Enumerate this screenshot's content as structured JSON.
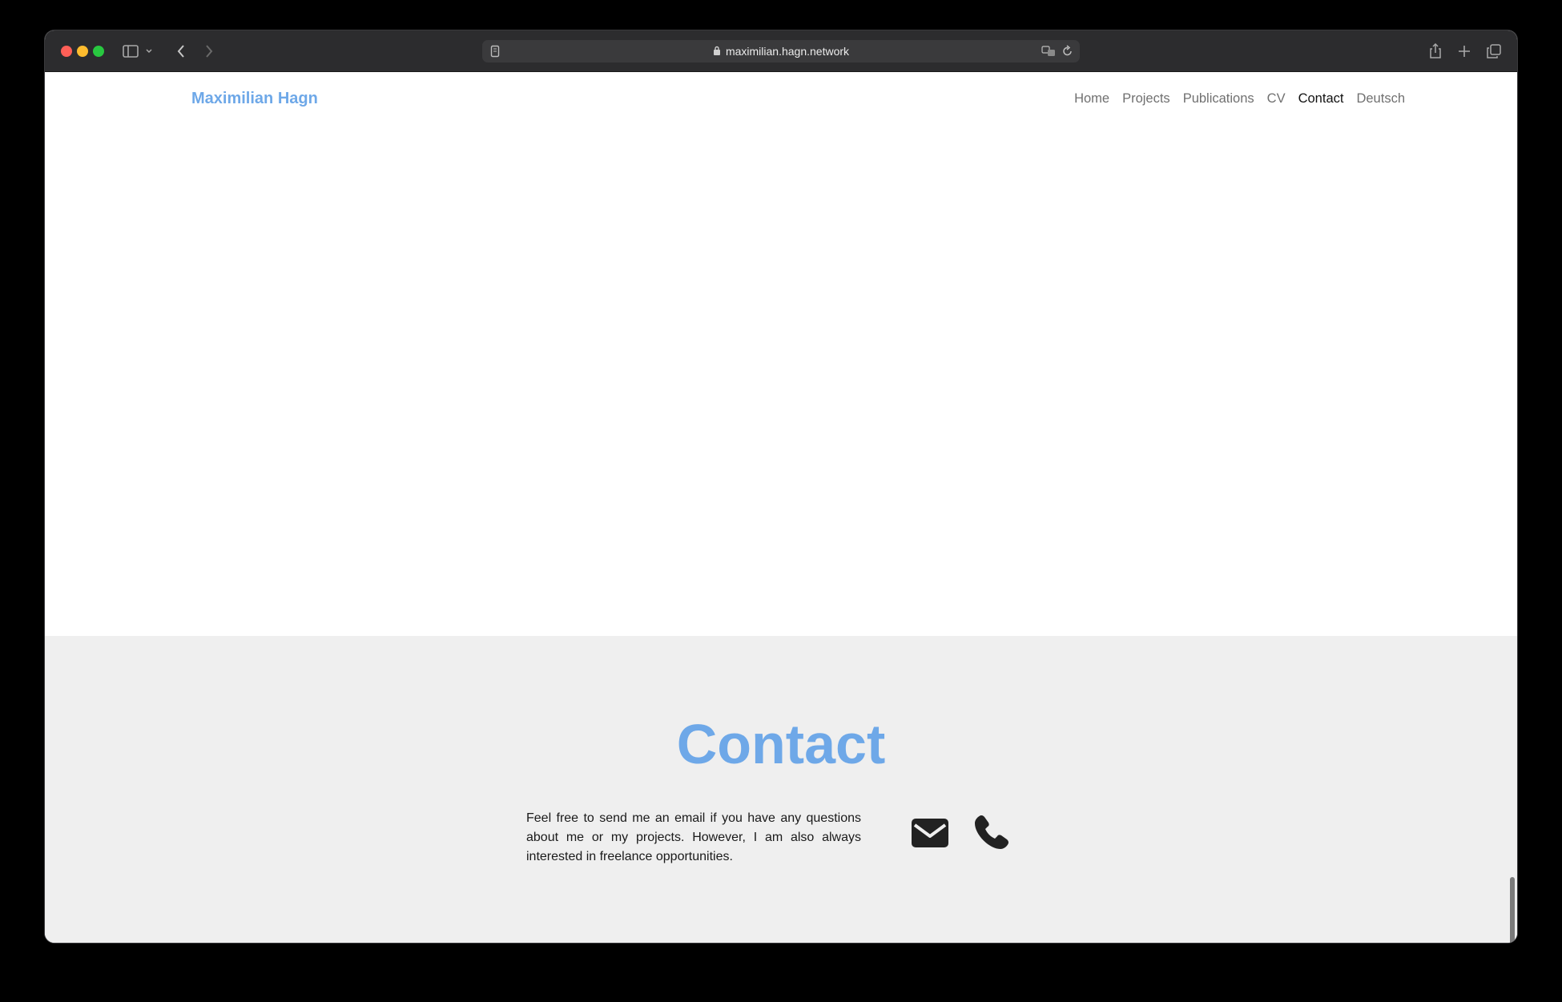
{
  "browser": {
    "url": "maximilian.hagn.network"
  },
  "site": {
    "brand": "Maximilian Hagn",
    "nav": [
      {
        "label": "Home",
        "active": false
      },
      {
        "label": "Projects",
        "active": false
      },
      {
        "label": "Publications",
        "active": false
      },
      {
        "label": "CV",
        "active": false
      },
      {
        "label": "Contact",
        "active": true
      },
      {
        "label": "Deutsch",
        "active": false
      }
    ]
  },
  "contact": {
    "title": "Contact",
    "text": "Feel free to send me an email if you have any questions about me or my projects. However, I am also always interested in freelance opportunities.",
    "icons": [
      "envelope-icon",
      "phone-icon"
    ]
  },
  "colors": {
    "accent": "#6ea8e8",
    "section_bg": "#efefef",
    "toolbar_bg": "#2c2c2e"
  }
}
